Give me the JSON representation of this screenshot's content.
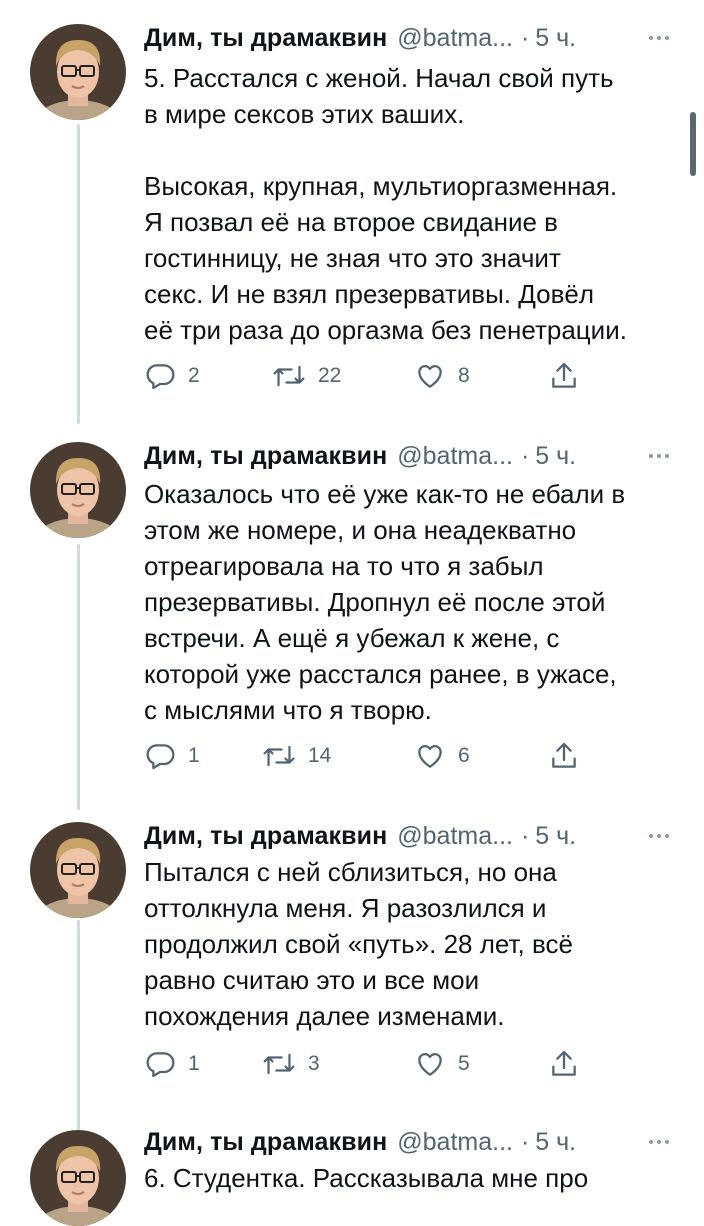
{
  "tweets": [
    {
      "author_name": "Дим, ты драмаквин",
      "handle": "@batma...",
      "separator": "·",
      "time": "5 ч.",
      "lines": [
        "5. Расстался с женой. Начал свой путь",
        "в мире сексов этих ваших.",
        "",
        "Высокая, крупная, мультиоргазменная.",
        "Я позвал её на второе свидание в",
        "гостинницу, не зная что это значит",
        "секс. И не взял презервативы. Довёл",
        "её три раза до оргазма без пенетрации."
      ],
      "replies": "2",
      "retweets": "22",
      "likes": "8"
    },
    {
      "author_name": "Дим, ты драмаквин",
      "handle": "@batma...",
      "separator": "·",
      "time": "5 ч.",
      "lines": [
        "Оказалось что её уже как-то не ебали в",
        "этом же номере, и она неадекватно",
        "отреагировала на то что я забыл",
        "презервативы. Дропнул её после этой",
        "встречи. А ещё я убежал к жене, с",
        "которой уже расстался ранее, в ужасе,",
        "с мыслями что я творю."
      ],
      "replies": "1",
      "retweets": "14",
      "likes": "6"
    },
    {
      "author_name": "Дим, ты драмаквин",
      "handle": "@batma...",
      "separator": "·",
      "time": "5 ч.",
      "lines": [
        "Пытался с ней сблизиться, но она",
        "оттолкнула меня. Я разозлился и",
        "продолжил свой «путь». 28 лет, всё",
        "равно считаю это и все мои",
        "похождения далее изменами."
      ],
      "replies": "1",
      "retweets": "3",
      "likes": "5"
    },
    {
      "author_name": "Дим, ты драмаквин",
      "handle": "@batma...",
      "separator": "·",
      "time": "5 ч.",
      "lines": [
        "6. Студентка. Рассказывала мне про"
      ]
    }
  ],
  "icons": {
    "reply": "reply-icon",
    "retweet": "retweet-icon",
    "like": "heart-icon",
    "share": "share-icon",
    "more": "more-icon"
  },
  "colors": {
    "text": "#0f1419",
    "secondary": "#536471",
    "thread_line": "#cfd9de"
  }
}
